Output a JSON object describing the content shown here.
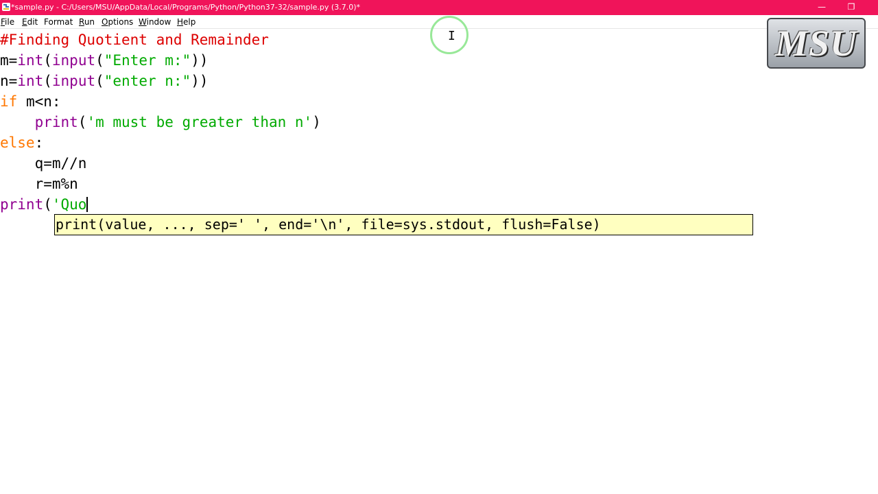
{
  "window": {
    "title": "*sample.py - C:/Users/MSU/AppData/Local/Programs/Python/Python37-32/sample.py (3.7.0)*",
    "minimize_glyph": "—",
    "restore_glyph": "❐",
    "titlebar_color": "#f0145a"
  },
  "menu": {
    "items": [
      {
        "acc": "F",
        "rest": "ile"
      },
      {
        "acc": "E",
        "rest": "dit"
      },
      {
        "acc": "",
        "rest": "Format"
      },
      {
        "acc": "R",
        "rest": "un"
      },
      {
        "acc": "O",
        "rest": "ptions"
      },
      {
        "acc": "W",
        "rest": "indow"
      },
      {
        "acc": "H",
        "rest": "elp"
      }
    ]
  },
  "editor": {
    "lines": [
      {
        "indent": "",
        "tokens": [
          {
            "t": "comment",
            "v": "#Finding Quotient and Remainder"
          }
        ]
      },
      {
        "indent": "",
        "tokens": [
          {
            "t": "plain",
            "v": "m="
          },
          {
            "t": "builtin",
            "v": "int"
          },
          {
            "t": "plain",
            "v": "("
          },
          {
            "t": "builtin",
            "v": "input"
          },
          {
            "t": "plain",
            "v": "("
          },
          {
            "t": "string",
            "v": "\"Enter m:\""
          },
          {
            "t": "plain",
            "v": "))"
          }
        ]
      },
      {
        "indent": "",
        "tokens": [
          {
            "t": "plain",
            "v": "n="
          },
          {
            "t": "builtin",
            "v": "int"
          },
          {
            "t": "plain",
            "v": "("
          },
          {
            "t": "builtin",
            "v": "input"
          },
          {
            "t": "plain",
            "v": "("
          },
          {
            "t": "string",
            "v": "\"enter n:\""
          },
          {
            "t": "plain",
            "v": "))"
          }
        ]
      },
      {
        "indent": "",
        "tokens": [
          {
            "t": "keyword",
            "v": "if"
          },
          {
            "t": "plain",
            "v": " m<n:"
          }
        ]
      },
      {
        "indent": "    ",
        "tokens": [
          {
            "t": "builtin",
            "v": "print"
          },
          {
            "t": "plain",
            "v": "("
          },
          {
            "t": "string",
            "v": "'m must be greater than n'"
          },
          {
            "t": "plain",
            "v": ")"
          }
        ]
      },
      {
        "indent": "",
        "tokens": [
          {
            "t": "keyword",
            "v": "else"
          },
          {
            "t": "plain",
            "v": ":"
          }
        ]
      },
      {
        "indent": "    ",
        "tokens": [
          {
            "t": "plain",
            "v": "q=m//n"
          }
        ]
      },
      {
        "indent": "    ",
        "tokens": [
          {
            "t": "plain",
            "v": "r=m%n"
          }
        ]
      },
      {
        "indent": "",
        "tokens": [
          {
            "t": "builtin",
            "v": "print"
          },
          {
            "t": "plain",
            "v": "("
          },
          {
            "t": "string",
            "v": "'Quo"
          }
        ]
      }
    ],
    "cursor_line": 9
  },
  "calltip": {
    "text": "print(value, ..., sep=' ', end='\\n', file=sys.stdout, flush=False)"
  },
  "logo": {
    "text": "MSU"
  },
  "colors": {
    "comment": "#dd0000",
    "builtin": "#900090",
    "string": "#00aa00",
    "keyword": "#ff7700",
    "calltip_bg": "#ffffc0"
  }
}
